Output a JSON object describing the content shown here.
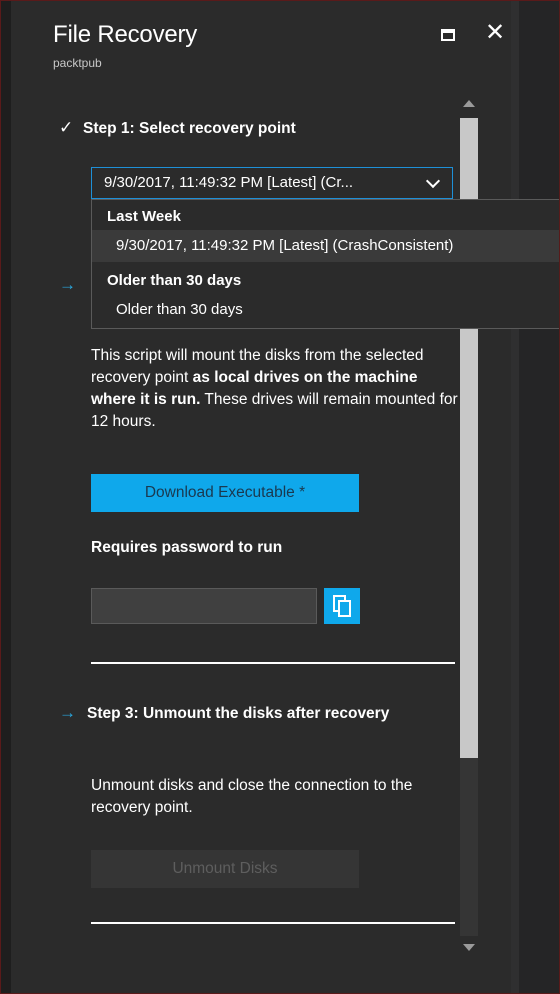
{
  "blade": {
    "title": "File Recovery",
    "subtitle": "packtpub"
  },
  "step1": {
    "label": "Step 1: Select recovery point",
    "dropdown_value": "9/30/2017, 11:49:32 PM [Latest] (Cr...",
    "groups": [
      {
        "header": "Last Week",
        "options": [
          "9/30/2017, 11:49:32 PM [Latest] (CrashConsistent)"
        ]
      },
      {
        "header": "Older than 30 days",
        "options": [
          "Older than 30 days"
        ]
      }
    ]
  },
  "step2": {
    "description_part1": "This script will mount the disks from the selected recovery point ",
    "description_bold": "as local drives on the machine where it is run.",
    "description_part2": " These drives will remain mounted for 12 hours.",
    "download_label": "Download Executable *",
    "password_label": "Requires password to run",
    "password_value": ""
  },
  "step3": {
    "label": "Step 3: Unmount the disks after recovery",
    "description": "Unmount disks and close the connection to the recovery point.",
    "unmount_label": "Unmount Disks"
  },
  "colors": {
    "accent": "#0fa8eb",
    "arrow": "#2aa9e0",
    "background": "#2b2b2b"
  },
  "icons": {
    "maximize": "maximize-icon",
    "close": "close-icon",
    "check": "check-icon",
    "arrow": "arrow-right-icon",
    "copy": "copy-icon"
  }
}
